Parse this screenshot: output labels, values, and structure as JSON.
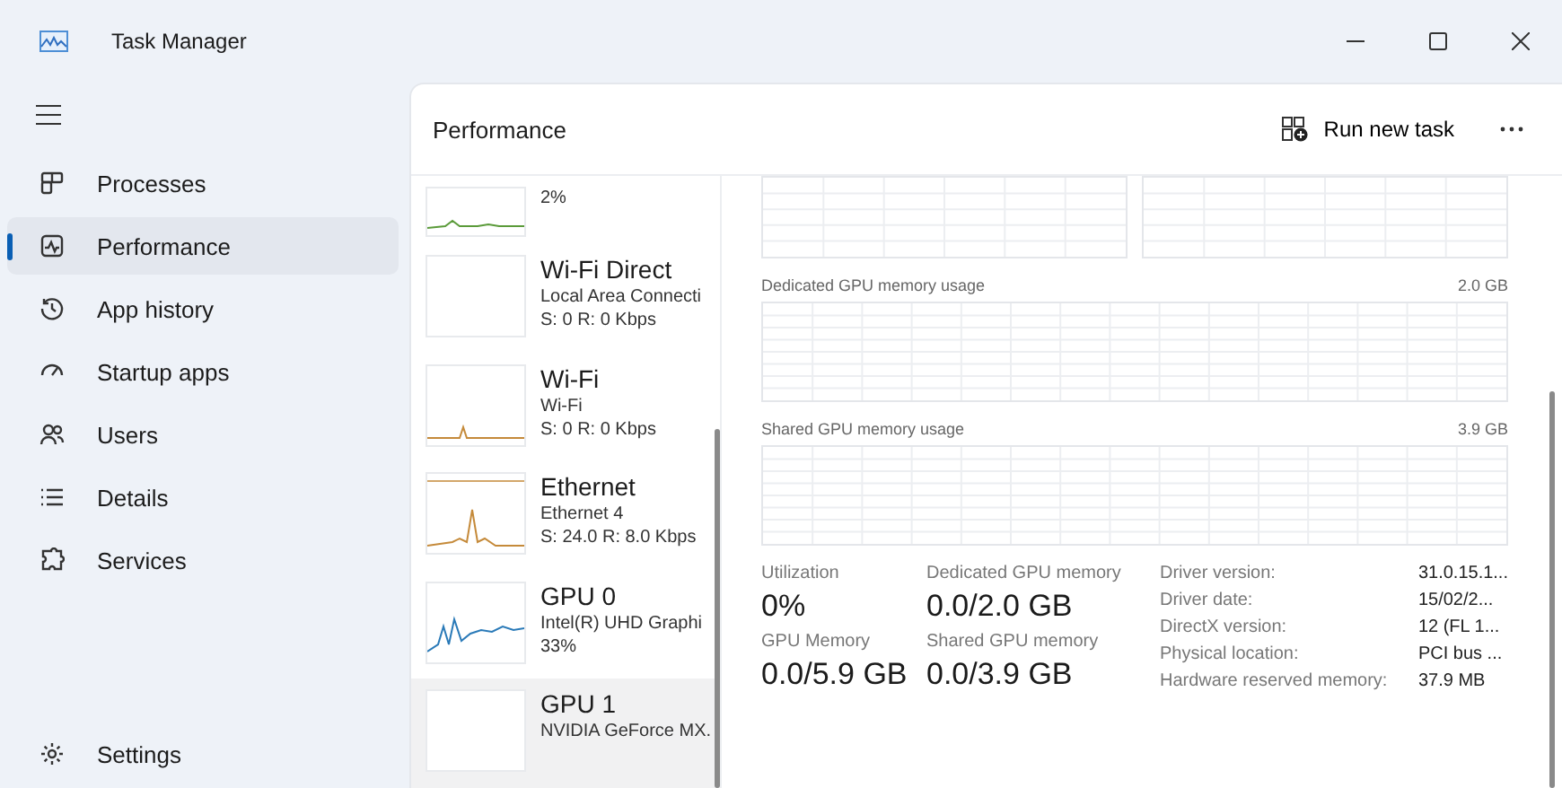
{
  "window": {
    "title": "Task Manager"
  },
  "sidebar": {
    "items": [
      {
        "label": "Processes",
        "kind": "processes",
        "selected": false
      },
      {
        "label": "Performance",
        "kind": "performance",
        "selected": true
      },
      {
        "label": "App history",
        "kind": "history",
        "selected": false
      },
      {
        "label": "Startup apps",
        "kind": "startup",
        "selected": false
      },
      {
        "label": "Users",
        "kind": "users",
        "selected": false
      },
      {
        "label": "Details",
        "kind": "details",
        "selected": false
      },
      {
        "label": "Services",
        "kind": "services",
        "selected": false
      }
    ],
    "footer_item": {
      "label": "Settings"
    }
  },
  "header": {
    "title": "Performance",
    "run_button": "Run new task"
  },
  "devices": [
    {
      "kind": "disk",
      "lines": [
        "2%"
      ],
      "selected": false
    },
    {
      "kind": "blank",
      "name": "Wi-Fi Direct",
      "lines": [
        "Local Area Connecti",
        "S: 0 R: 0 Kbps"
      ],
      "selected": false
    },
    {
      "kind": "wifi",
      "name": "Wi-Fi",
      "lines": [
        "Wi-Fi",
        "S: 0 R: 0 Kbps"
      ],
      "selected": false
    },
    {
      "kind": "ethernet",
      "name": "Ethernet",
      "lines": [
        "Ethernet 4",
        "S: 24.0 R: 8.0 Kbps"
      ],
      "selected": false
    },
    {
      "kind": "gpu",
      "name": "GPU 0",
      "lines": [
        "Intel(R) UHD Graphi",
        "33%"
      ],
      "selected": false
    },
    {
      "kind": "blank",
      "name": "GPU 1",
      "lines": [
        "NVIDIA GeForce MX."
      ],
      "selected": true
    }
  ],
  "detail": {
    "graphs": [
      {
        "label": "Dedicated GPU memory usage",
        "max": "2.0 GB"
      },
      {
        "label": "Shared GPU memory usage",
        "max": "3.9 GB"
      }
    ],
    "stats": [
      {
        "label": "Utilization",
        "value": "0%"
      },
      {
        "label": "Dedicated GPU memory",
        "value": "0.0/2.0 GB"
      },
      {
        "label": "GPU Memory",
        "value": "0.0/5.9 GB"
      },
      {
        "label": "Shared GPU memory",
        "value": "0.0/3.9 GB"
      }
    ],
    "properties": [
      {
        "label": "Driver version:",
        "value": "31.0.15.1..."
      },
      {
        "label": "Driver date:",
        "value": "15/02/2..."
      },
      {
        "label": "DirectX version:",
        "value": "12 (FL 1..."
      },
      {
        "label": "Physical location:",
        "value": "PCI bus ..."
      },
      {
        "label": "Hardware reserved memory:",
        "value": "37.9 MB"
      }
    ]
  }
}
